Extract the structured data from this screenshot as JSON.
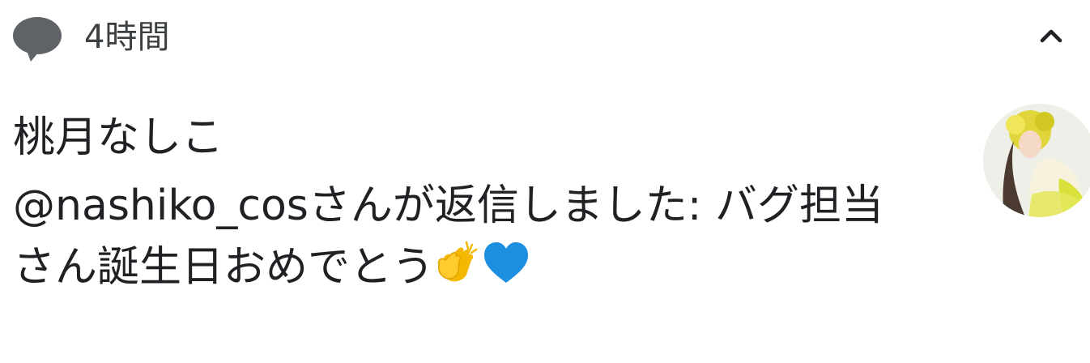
{
  "notification": {
    "time_ago": "4時間",
    "title": "桃月なしこ",
    "message_line1": "@nashiko_cosさんが返信しました: バグ担当",
    "message_line2": "さん誕生日おめでとう",
    "emojis": [
      "clapping-hands-emoji",
      "blue-heart-emoji"
    ],
    "app_icon": "speech-bubble-icon",
    "collapse_icon": "chevron-up-icon",
    "colors": {
      "app_icon": "#5f6368",
      "text_primary": "#202124",
      "text_secondary": "#3c4043",
      "avatar_accent": "#d8e23a",
      "heart": "#1d8fe0",
      "clap": "#f5b800"
    }
  }
}
